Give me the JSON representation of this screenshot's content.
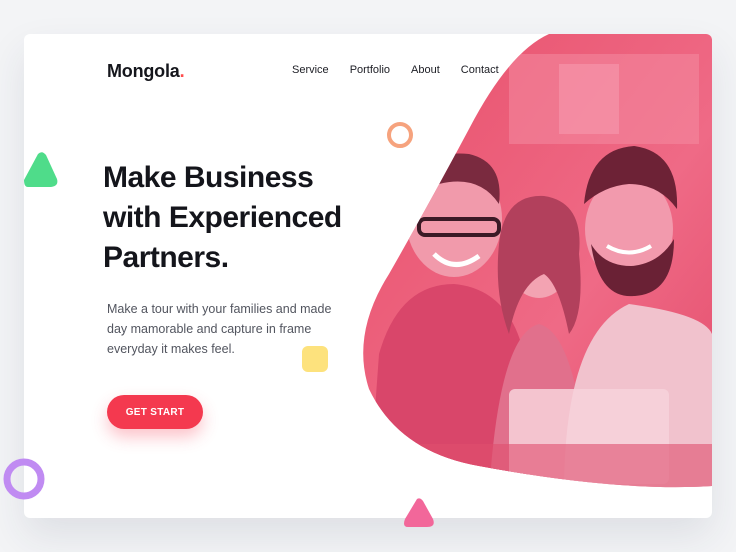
{
  "brand": {
    "name": "Mongola",
    "dot": ".",
    "accent": "#ff4d4d"
  },
  "nav": {
    "items": [
      {
        "label": "Service"
      },
      {
        "label": "Portfolio"
      },
      {
        "label": "About"
      },
      {
        "label": "Contact"
      }
    ]
  },
  "hero": {
    "headline_lines": [
      "Make Business",
      "with Experienced",
      "Partners."
    ],
    "description_lines": [
      "Make a tour with your families and made",
      "day mamorable and capture in frame",
      "everyday it makes feel."
    ],
    "cta_label": "GET START"
  },
  "colors": {
    "primary": "#f4394f",
    "photo_tint": "#f0587a",
    "green_shape": "#4fdc8a",
    "orange_ring": "#f6a37e",
    "yellow_square": "#fde27d",
    "purple_ring": "#c08bf2",
    "pink_shape": "#f2679a"
  },
  "icons": {
    "decorations": [
      "green-triangle-icon",
      "orange-ring-icon",
      "yellow-square-icon",
      "purple-ring-icon",
      "pink-triangle-icon"
    ]
  }
}
